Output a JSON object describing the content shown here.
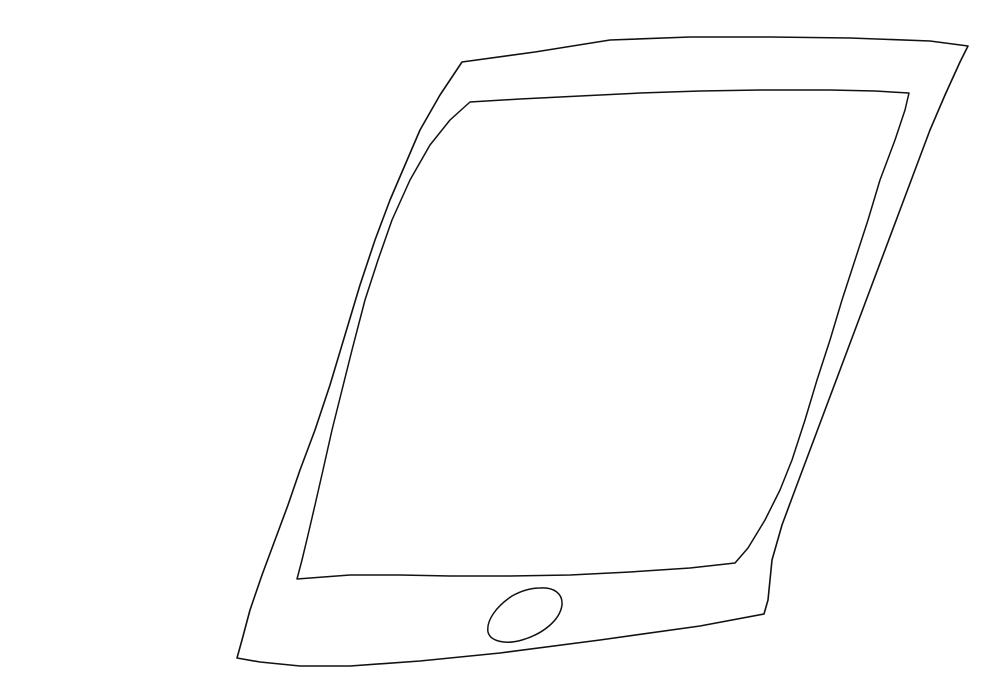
{
  "drawing": {
    "subject": "tablet-device",
    "style": "hand-drawn-line-sketch",
    "background_color": "#ffffff",
    "stroke_color": "#111111",
    "parts": [
      {
        "name": "tablet-outer-frame"
      },
      {
        "name": "tablet-screen"
      },
      {
        "name": "tablet-home-button"
      }
    ]
  }
}
